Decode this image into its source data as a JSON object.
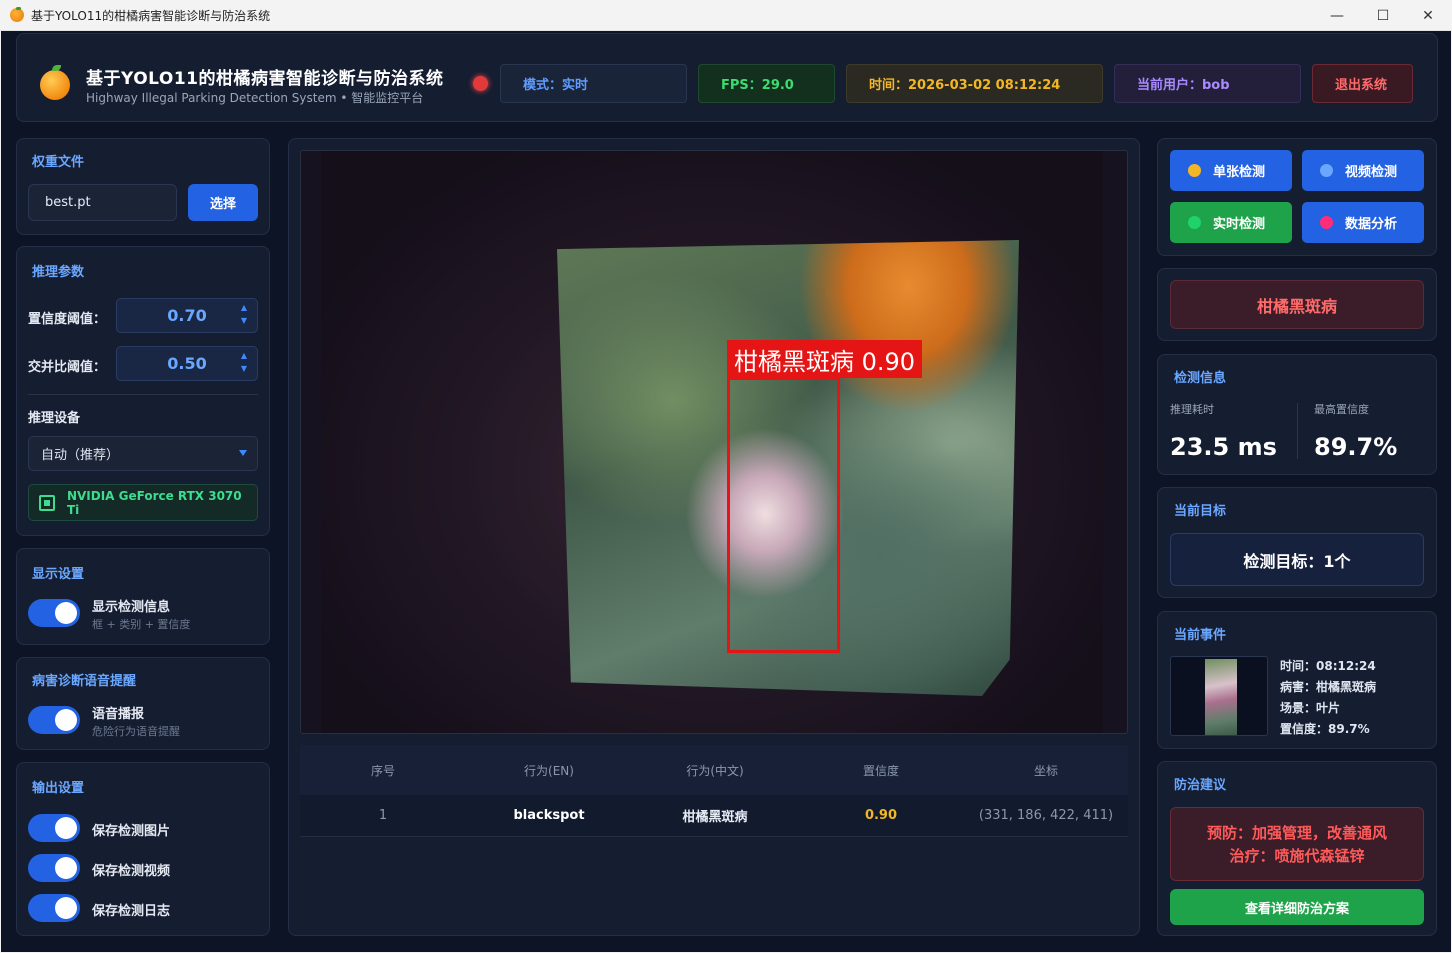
{
  "window": {
    "title": "基于YOLO11的柑橘病害智能诊断与防治系统",
    "min": "—",
    "max": "☐",
    "close": "✕"
  },
  "header": {
    "title": "基于YOLO11的柑橘病害智能诊断与防治系统",
    "subtitle": "Highway Illegal Parking Detection System • 智能监控平台",
    "mode": "模式：实时",
    "fps": "FPS：29.0",
    "time": "时间：2026-03-02 08:12:24",
    "user": "当前用户：bob",
    "exit": "退出系统"
  },
  "weights": {
    "title": "权重文件",
    "value": "best.pt",
    "select_label": "选择"
  },
  "inference": {
    "title": "推理参数",
    "conf_label": "置信度阈值：",
    "conf_value": "0.70",
    "iou_label": "交并比阈值：",
    "iou_value": "0.50",
    "device_label": "推理设备",
    "device_value": "自动（推荐）",
    "gpu": "NVIDIA GeForce RTX 3070 Ti"
  },
  "display": {
    "title": "显示设置",
    "toggle_label": "显示检测信息",
    "toggle_sub": "框 + 类别 + 置信度",
    "on": true
  },
  "voice": {
    "title": "病害诊断语音提醒",
    "toggle_label": "语音播报",
    "toggle_sub": "危险行为语音提醒",
    "on": true
  },
  "output": {
    "title": "输出设置",
    "items": [
      {
        "label": "保存检测图片",
        "on": true
      },
      {
        "label": "保存检测视频",
        "on": true
      },
      {
        "label": "保存检测日志",
        "on": true
      }
    ]
  },
  "video": {
    "detection_label": "柑橘黑斑病 0.90"
  },
  "table": {
    "headers": [
      "序号",
      "行为(EN)",
      "行为(中文)",
      "置信度",
      "坐标"
    ],
    "rows": [
      {
        "idx": "1",
        "en": "blackspot",
        "cn": "柑橘黑斑病",
        "conf": "0.90",
        "coord": "(331, 186, 422, 411)"
      }
    ]
  },
  "modes": {
    "single": "单张检测",
    "video": "视频检测",
    "realtime": "实时检测",
    "analysis": "数据分析",
    "colors": {
      "single": "#f3b627",
      "video": "#6aa7ff",
      "realtime": "#1fd26a",
      "analysis": "#ff2d78"
    }
  },
  "result": {
    "disease": "柑橘黑斑病"
  },
  "detect_info": {
    "title": "检测信息",
    "time_label": "推理耗时",
    "time_value": "23.5 ms",
    "conf_label": "最高置信度",
    "conf_value": "89.7%"
  },
  "current_target": {
    "title": "当前目标",
    "value": "检测目标：1个"
  },
  "current_event": {
    "title": "当前事件",
    "time": "时间：08:12:24",
    "disease": "病害：柑橘黑斑病",
    "scene": "场景：叶片",
    "conf": "置信度：89.7%"
  },
  "advice": {
    "title": "防治建议",
    "prevent": "预防：加强管理，改善通风",
    "treat": "治疗：喷施代森锰锌",
    "plan_button": "查看详细防治方案"
  }
}
